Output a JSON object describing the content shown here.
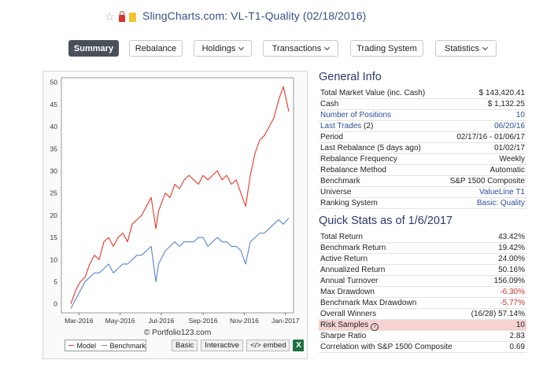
{
  "window": {
    "title": "SlingCharts.com: VL-T1-Quality (02/18/2016)"
  },
  "tabs": [
    {
      "label": "Summary",
      "active": true
    },
    {
      "label": "Rebalance"
    },
    {
      "label": "Holdings"
    },
    {
      "label": "Transactions"
    },
    {
      "label": "Trading System"
    },
    {
      "label": "Statistics"
    }
  ],
  "chart_data": {
    "type": "line",
    "x": [
      "2016-02-18",
      "2016-02-25",
      "2016-03-03",
      "2016-03-10",
      "2016-03-17",
      "2016-03-24",
      "2016-03-31",
      "2016-04-07",
      "2016-04-14",
      "2016-04-21",
      "2016-04-28",
      "2016-05-05",
      "2016-05-12",
      "2016-05-19",
      "2016-05-26",
      "2016-06-02",
      "2016-06-09",
      "2016-06-16",
      "2016-06-23",
      "2016-06-27",
      "2016-07-07",
      "2016-07-14",
      "2016-07-21",
      "2016-07-28",
      "2016-08-04",
      "2016-08-11",
      "2016-08-18",
      "2016-08-25",
      "2016-09-01",
      "2016-09-08",
      "2016-09-15",
      "2016-09-22",
      "2016-09-29",
      "2016-10-06",
      "2016-10-13",
      "2016-10-20",
      "2016-10-27",
      "2016-11-03",
      "2016-11-10",
      "2016-11-17",
      "2016-11-24",
      "2016-12-01",
      "2016-12-08",
      "2016-12-15",
      "2016-12-22",
      "2016-12-29",
      "2017-01-06"
    ],
    "series": [
      {
        "name": "Model",
        "color": "#e8352b",
        "values": [
          0,
          3,
          5,
          6,
          9,
          11,
          10,
          14,
          15,
          13,
          15,
          16,
          14,
          18,
          19,
          20,
          22,
          24,
          17,
          21,
          25,
          24,
          27,
          26,
          28,
          29,
          28,
          27,
          29,
          28,
          29,
          30,
          28,
          29,
          27,
          28,
          25,
          22,
          29,
          34,
          37,
          38,
          40,
          42,
          46,
          49,
          43.4
        ]
      },
      {
        "name": "Benchmark",
        "color": "#5a82cc",
        "values": [
          -1,
          1,
          3,
          5,
          6,
          7,
          7,
          8,
          9,
          7,
          8,
          9,
          9,
          10,
          11,
          11,
          12,
          13,
          5,
          9,
          12,
          13,
          14,
          13,
          14,
          14,
          14,
          15,
          15,
          13,
          14,
          15,
          14,
          14,
          13,
          13,
          12,
          9,
          14,
          15,
          16,
          16,
          17,
          18,
          19,
          18,
          19.4
        ]
      }
    ],
    "xticks": [
      "Mar-2016",
      "May-2016",
      "Jul-2016",
      "Sep-2016",
      "Nov-2016",
      "Jan-2017"
    ],
    "yticks": [
      0,
      5,
      10,
      15,
      20,
      25,
      30,
      35,
      40,
      45,
      50
    ],
    "ylim": [
      -2,
      51
    ],
    "grid": false,
    "legend": "bottom-left"
  },
  "chart_footer": {
    "credit": "© Portfolio123.com",
    "legend_model": "Model",
    "legend_benchmark": "Benchmark",
    "btn_basic": "Basic",
    "btn_interactive": "Interactive",
    "btn_embed": "</> embed",
    "excel_icon": "X"
  },
  "general_info": {
    "title": "General Info",
    "rows": [
      {
        "label": "Total Market Value (inc. Cash)",
        "value": "$ 143,420.41"
      },
      {
        "label": "Cash",
        "value": "$ 1,132.25"
      },
      {
        "label": "Number of Positions",
        "value": "10"
      },
      {
        "label": "Last Trades",
        "count": "(2)",
        "value": "06/20/16"
      },
      {
        "label": "Period",
        "value": "02/17/16 - 01/06/17"
      },
      {
        "label": "Last Rebalance (5 days ago)",
        "value": "01/02/17"
      },
      {
        "label": "Rebalance Frequency",
        "value": "Weekly"
      },
      {
        "label": "Rebalance Method",
        "value": "Automatic"
      },
      {
        "label": "Benchmark",
        "value": "S&P 1500 Composite"
      },
      {
        "label": "Universe",
        "value": "ValueLine T1"
      },
      {
        "label": "Ranking System",
        "value": "Basic: Quality"
      }
    ]
  },
  "quick_stats": {
    "title": "Quick Stats as of 1/6/2017",
    "rows": [
      {
        "label": "Total Return",
        "value": "43.42%"
      },
      {
        "label": "Benchmark Return",
        "value": "19.42%"
      },
      {
        "label": "Active Return",
        "value": "24.00%"
      },
      {
        "label": "Annualized Return",
        "value": "50.16%"
      },
      {
        "label": "Annual Turnover",
        "value": "156.09%"
      },
      {
        "label": "Max Drawdown",
        "value": "-6.30%"
      },
      {
        "label": "Benchmark Max Drawdown",
        "value": "-5.77%"
      },
      {
        "label": "Overall Winners",
        "value": "(16/28) 57.14%"
      },
      {
        "label": "Risk Samples",
        "value": "10"
      },
      {
        "label": "Sharpe Ratio",
        "value": "2.83"
      },
      {
        "label": "Correlation with S&P 1500 Composite",
        "value": "0.69"
      }
    ]
  },
  "colors": {
    "link": "#2d4d9a",
    "negative": "#d42f2f",
    "highlight": "#f6d3d3",
    "active_tab": "#49505a"
  }
}
